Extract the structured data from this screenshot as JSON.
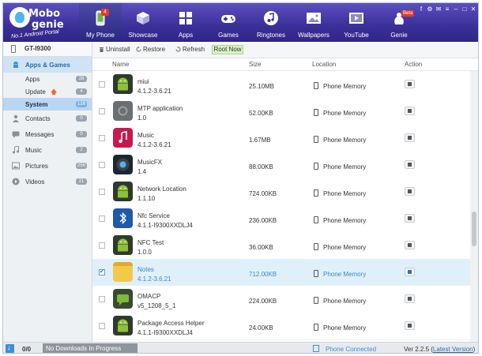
{
  "app": {
    "logo_line1": "Mobo",
    "logo_line2": "genie",
    "logo_sub": "No.1 Android Portal"
  },
  "nav": [
    {
      "label": "My Phone",
      "icon": "phone-icon",
      "badge": "4"
    },
    {
      "label": "Showcase",
      "icon": "box-icon"
    },
    {
      "label": "Apps",
      "icon": "apps-grid-icon"
    },
    {
      "label": "Games",
      "icon": "gamepad-icon"
    },
    {
      "label": "Ringtones",
      "icon": "music-note-icon"
    },
    {
      "label": "Wallpapers",
      "icon": "picture-icon"
    },
    {
      "label": "YouTube",
      "icon": "video-icon"
    },
    {
      "label": "Genie",
      "icon": "genie-icon",
      "badge": "Beta"
    }
  ],
  "device": {
    "name": "GT-I9300"
  },
  "sidebar": {
    "apps_games": {
      "label": "Apps & Games",
      "icon": "android-icon"
    },
    "sub": [
      {
        "label": "Apps",
        "count": "28"
      },
      {
        "label": "Update",
        "count": "4",
        "icon": "arrow-up-icon"
      },
      {
        "label": "System",
        "count": "126"
      }
    ],
    "items": [
      {
        "label": "Contacts",
        "count": "0",
        "icon": "contact-icon"
      },
      {
        "label": "Messages",
        "count": "0",
        "icon": "message-icon"
      },
      {
        "label": "Music",
        "count": "2",
        "icon": "music-icon"
      },
      {
        "label": "Pictures",
        "count": "256",
        "icon": "picture-icon"
      },
      {
        "label": "Videos",
        "count": "21",
        "icon": "video-icon"
      }
    ]
  },
  "toolbar": {
    "uninstall": "Uninstall",
    "restore": "Restore",
    "refresh": "Refresh",
    "root": "Root Now"
  },
  "columns": {
    "name": "Name",
    "size": "Size",
    "location": "Location",
    "action": "Action"
  },
  "rows": [
    {
      "name": "miui",
      "version": "4.1.2-3.6.21",
      "size": "25.10MB",
      "location": "Phone Memory",
      "icon": "android-icon",
      "checked": false,
      "highlight": false
    },
    {
      "name": "MTP application",
      "version": "1.0",
      "size": "52.00KB",
      "location": "Phone Memory",
      "icon": "gear-icon",
      "checked": false,
      "highlight": false
    },
    {
      "name": "Music",
      "version": "4.1.2-3.6.21",
      "size": "1.67MB",
      "location": "Phone Memory",
      "icon": "music-app-icon",
      "checked": false,
      "highlight": false
    },
    {
      "name": "MusicFX",
      "version": "1.4",
      "size": "88.00KB",
      "location": "Phone Memory",
      "icon": "speaker-icon",
      "checked": false,
      "highlight": false
    },
    {
      "name": "Network Location",
      "version": "1.1.10",
      "size": "724.00KB",
      "location": "Phone Memory",
      "icon": "android-icon",
      "checked": false,
      "highlight": false
    },
    {
      "name": "Nfc Service",
      "version": "4.1.1-I9300XXDLJ4",
      "size": "236.00KB",
      "location": "Phone Memory",
      "icon": "bluetooth-icon",
      "checked": false,
      "highlight": false
    },
    {
      "name": "NFC Test",
      "version": "1.0.0",
      "size": "36.00KB",
      "location": "Phone Memory",
      "icon": "android-icon",
      "checked": false,
      "highlight": false
    },
    {
      "name": "Notes",
      "version": "4.1.2-3.6.21",
      "size": "712.00KB",
      "location": "Phone Memory",
      "icon": "notes-icon",
      "checked": true,
      "highlight": true
    },
    {
      "name": "OMACP",
      "version": "v5_1208_5_1",
      "size": "224.00KB",
      "location": "Phone Memory",
      "icon": "message-app-icon",
      "checked": false,
      "highlight": false
    },
    {
      "name": "Package Access Helper",
      "version": "4.1.1-I9300XXDLJ4",
      "size": "24.00KB",
      "location": "Phone Memory",
      "icon": "android-icon",
      "checked": false,
      "highlight": false
    }
  ],
  "status": {
    "count": "0/0",
    "message": "No Downloads In Progress",
    "connection": "Phone Connected",
    "version_label": "Ver  2.2.5 (",
    "latest": "Latest Version",
    "close_paren": ")"
  },
  "colors": {
    "header": "#3b2f98",
    "accent": "#3a86c8",
    "selected_row": "#dff0fb",
    "root_button": "#d9f2c4"
  }
}
